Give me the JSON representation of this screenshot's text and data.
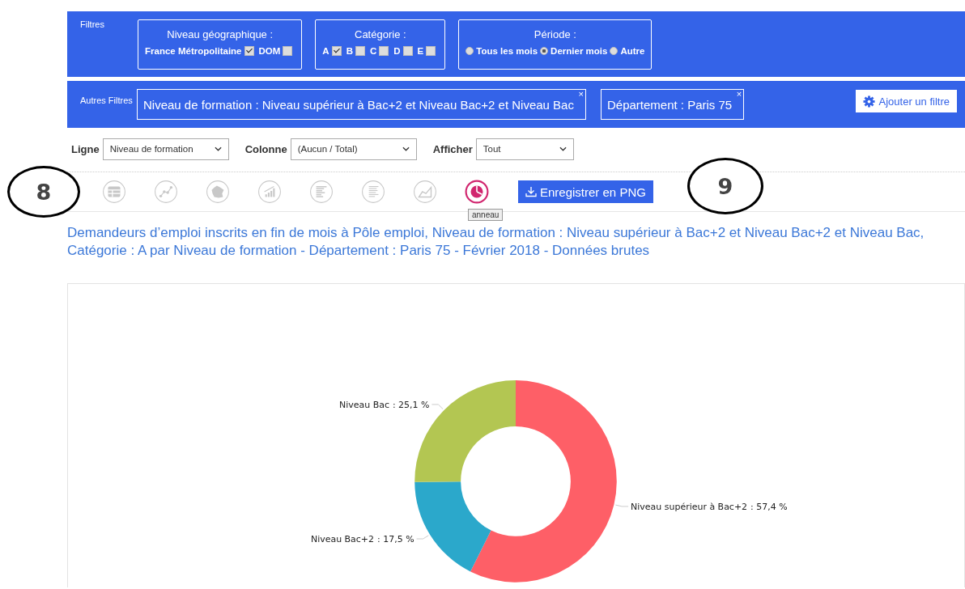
{
  "filters": {
    "label": "Filtres",
    "groups": [
      {
        "title": "Niveau géographique :",
        "kind": "checkbox",
        "options": [
          {
            "label": "France Métropolitaine",
            "checked": true
          },
          {
            "label": "DOM",
            "checked": false
          }
        ]
      },
      {
        "title": "Catégorie :",
        "kind": "checkbox",
        "options": [
          {
            "label": "A",
            "checked": true
          },
          {
            "label": "B",
            "checked": false
          },
          {
            "label": "C",
            "checked": false
          },
          {
            "label": "D",
            "checked": false
          },
          {
            "label": "E",
            "checked": false
          }
        ]
      },
      {
        "title": "Période :",
        "kind": "radio",
        "options": [
          {
            "label": "Tous les mois",
            "selected": false
          },
          {
            "label": "Dernier mois",
            "selected": true
          },
          {
            "label": "Autre",
            "selected": false
          }
        ]
      }
    ]
  },
  "other_filters": {
    "label": "Autres Filtres",
    "chips": [
      {
        "text": "Niveau de formation : Niveau supérieur à Bac+2 et Niveau Bac+2 et Niveau Bac",
        "close": "×"
      },
      {
        "text": "Département : Paris 75",
        "close": "×"
      }
    ],
    "add_button": "Ajouter un filtre"
  },
  "selectors": [
    {
      "label": "Ligne",
      "value": "Niveau de formation"
    },
    {
      "label": "Colonne",
      "value": "(Aucun / Total)"
    },
    {
      "label": "Afficher",
      "value": "Tout"
    }
  ],
  "chart_types": [
    {
      "kind": "table",
      "selected": false
    },
    {
      "kind": "scatter",
      "selected": false
    },
    {
      "kind": "map",
      "selected": false
    },
    {
      "kind": "bars",
      "selected": false
    },
    {
      "kind": "hbars",
      "selected": false
    },
    {
      "kind": "lines",
      "selected": false
    },
    {
      "kind": "area",
      "selected": false
    },
    {
      "kind": "donut",
      "selected": true,
      "tooltip": "anneau"
    }
  ],
  "export_button": "Enregistrer en PNG",
  "callouts": [
    "8",
    "9"
  ],
  "title": "Demandeurs d’emploi inscrits en fin de mois à Pôle emploi, Niveau de formation : Niveau supérieur à Bac+2 et Niveau Bac+2 et Niveau Bac, Catégorie : A par Niveau de formation - Département : Paris 75 - Février 2018 - Données brutes",
  "chart_data": {
    "type": "donut",
    "categories": [
      "Niveau supérieur à Bac+2",
      "Niveau Bac+2",
      "Niveau Bac"
    ],
    "values": [
      57.4,
      17.5,
      25.1
    ],
    "colors": [
      "#fe5f67",
      "#2ba8cb",
      "#b3c652"
    ],
    "value_labels": [
      ": 57,4 %",
      ": 17,5 %",
      ": 25,1 %"
    ]
  }
}
